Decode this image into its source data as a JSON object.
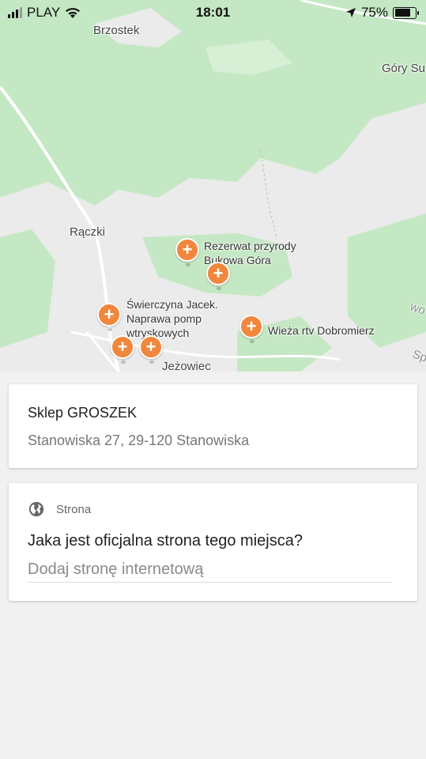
{
  "status_bar": {
    "carrier": "PLAY",
    "time": "18:01",
    "battery_percent": "75%",
    "battery_level": 0.75,
    "icons": [
      "signal-icon",
      "wifi-icon",
      "location-arrow-icon",
      "battery-icon"
    ]
  },
  "map": {
    "labels": {
      "brzostek": "Brzostek",
      "gory": "Góry Su",
      "raczki": "Rączki",
      "jezowiec": "Jeżowiec",
      "edge1": "wo",
      "edge2": "Sp"
    },
    "pois": {
      "rezerwat": "Rezerwat przyrody Bukowa Góra",
      "swierczyna": "Świerczyna Jacek. Naprawa pomp wtryskowych",
      "wieza": "Wieża rtv Dobromierz"
    },
    "colors": {
      "forest": "#c5e8c4",
      "land": "#ebebeb",
      "pin": "#f0873c"
    }
  },
  "place": {
    "name": "Sklep GROSZEK",
    "address": "Stanowiska 27, 29-120 Stanowiska"
  },
  "website": {
    "section_label": "Strona",
    "question": "Jaka jest oficjalna strona tego miejsca?",
    "placeholder": "Dodaj stronę internetową",
    "value": ""
  }
}
